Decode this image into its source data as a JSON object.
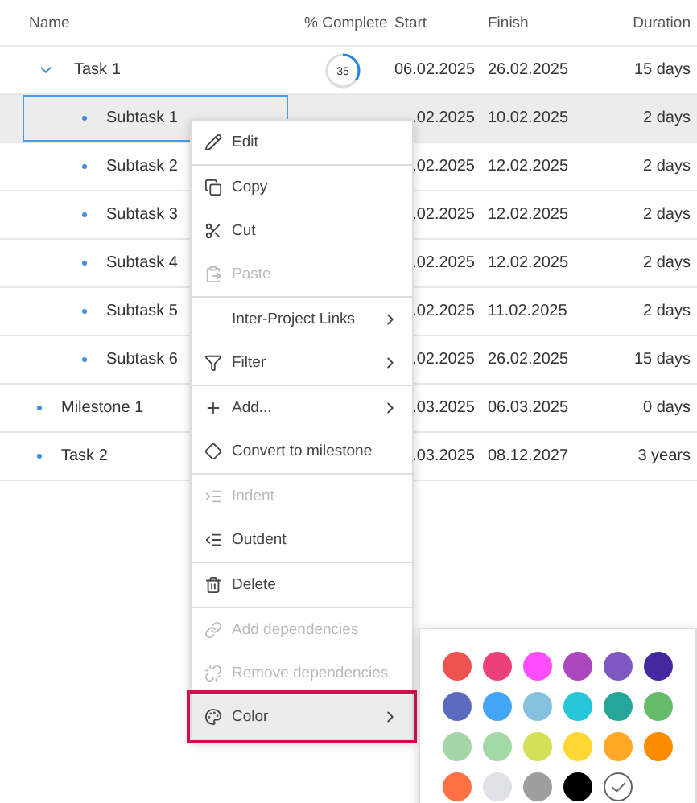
{
  "table": {
    "columns": [
      "Name",
      "% Complete",
      "Start",
      "Finish",
      "Duration"
    ],
    "rows": [
      {
        "name": "Task 1",
        "kind": "parent",
        "expanded": true,
        "selected": false,
        "complete": "35",
        "level": 0.35,
        "start": "06.02.2025",
        "finish": "26.02.2025",
        "duration": "15 days",
        "children": [
          {
            "name": "Subtask 1",
            "kind": "leaf",
            "selected": true,
            "start": ".02.2025",
            "finish": "10.02.2025",
            "duration": "2 days"
          },
          {
            "name": "Subtask 2",
            "kind": "leaf",
            "selected": false,
            "start": ".02.2025",
            "finish": "12.02.2025",
            "duration": "2 days"
          },
          {
            "name": "Subtask 3",
            "kind": "leaf",
            "selected": false,
            "start": ".02.2025",
            "finish": "12.02.2025",
            "duration": "2 days"
          },
          {
            "name": "Subtask 4",
            "kind": "leaf",
            "selected": false,
            "start": ".02.2025",
            "finish": "12.02.2025",
            "duration": "2 days"
          },
          {
            "name": "Subtask 5",
            "kind": "leaf",
            "selected": false,
            "start": ".02.2025",
            "finish": "11.02.2025",
            "duration": "2 days"
          },
          {
            "name": "Subtask 6",
            "kind": "leaf",
            "selected": false,
            "start": ".02.2025",
            "finish": "26.02.2025",
            "duration": "15 days"
          }
        ]
      },
      {
        "name": "Milestone 1",
        "kind": "leaf",
        "selected": false,
        "start": ".03.2025",
        "finish": "06.03.2025",
        "duration": "0 days"
      },
      {
        "name": "Task 2",
        "kind": "leaf",
        "selected": false,
        "start": ".03.2025",
        "finish": "08.12.2027",
        "duration": "3 years"
      }
    ]
  },
  "context_menu": {
    "groups": [
      [
        {
          "label": "Edit",
          "disabled": false,
          "submenu": false,
          "highlighted": false
        }
      ],
      [
        {
          "label": "Copy",
          "disabled": false,
          "submenu": false,
          "highlighted": false
        },
        {
          "label": "Cut",
          "disabled": false,
          "submenu": false,
          "highlighted": false
        },
        {
          "label": "Paste",
          "disabled": true,
          "submenu": false,
          "highlighted": false
        }
      ],
      [
        {
          "label": "Inter-Project Links",
          "disabled": false,
          "submenu": true,
          "highlighted": false
        },
        {
          "label": "Filter",
          "disabled": false,
          "submenu": true,
          "highlighted": false
        }
      ],
      [
        {
          "label": "Add...",
          "disabled": false,
          "submenu": true,
          "highlighted": false
        },
        {
          "label": "Convert to milestone",
          "disabled": false,
          "submenu": false,
          "highlighted": false
        }
      ],
      [
        {
          "label": "Indent",
          "disabled": true,
          "submenu": false,
          "highlighted": false
        },
        {
          "label": "Outdent",
          "disabled": false,
          "submenu": false,
          "highlighted": false
        }
      ],
      [
        {
          "label": "Delete",
          "disabled": false,
          "submenu": false,
          "highlighted": false
        }
      ],
      [
        {
          "label": "Add dependencies",
          "disabled": true,
          "submenu": false,
          "highlighted": false
        },
        {
          "label": "Remove dependencies",
          "disabled": true,
          "submenu": false,
          "highlighted": false
        },
        {
          "label": "Color",
          "disabled": false,
          "submenu": true,
          "highlighted": true
        }
      ]
    ]
  },
  "color_palette": [
    {
      "kind": "swatch",
      "color": "#ef5350"
    },
    {
      "kind": "swatch",
      "color": "#ec407a"
    },
    {
      "kind": "swatch",
      "color": "#ff4dff"
    },
    {
      "kind": "swatch",
      "color": "#ab47bc"
    },
    {
      "kind": "swatch",
      "color": "#7e57c2"
    },
    {
      "kind": "swatch",
      "color": "#4527a0"
    },
    {
      "kind": "swatch",
      "color": "#5c6bc0"
    },
    {
      "kind": "swatch",
      "color": "#42a5f5"
    },
    {
      "kind": "swatch",
      "color": "#86c1e0"
    },
    {
      "kind": "swatch",
      "color": "#26c6da"
    },
    {
      "kind": "swatch",
      "color": "#26a69a"
    },
    {
      "kind": "swatch",
      "color": "#66bb6a"
    },
    {
      "kind": "swatch",
      "color": "#a5d6a7"
    },
    {
      "kind": "swatch",
      "color": "#a2d9a5"
    },
    {
      "kind": "swatch",
      "color": "#d4e157"
    },
    {
      "kind": "swatch",
      "color": "#fdd835"
    },
    {
      "kind": "swatch",
      "color": "#ffa726"
    },
    {
      "kind": "swatch",
      "color": "#fb8c00"
    },
    {
      "kind": "swatch",
      "color": "#ff7043"
    },
    {
      "kind": "swatch",
      "color": "#dfe1e7"
    },
    {
      "kind": "swatch",
      "color": "#9e9e9e"
    },
    {
      "kind": "swatch",
      "color": "#000000"
    },
    {
      "kind": "none"
    }
  ]
}
